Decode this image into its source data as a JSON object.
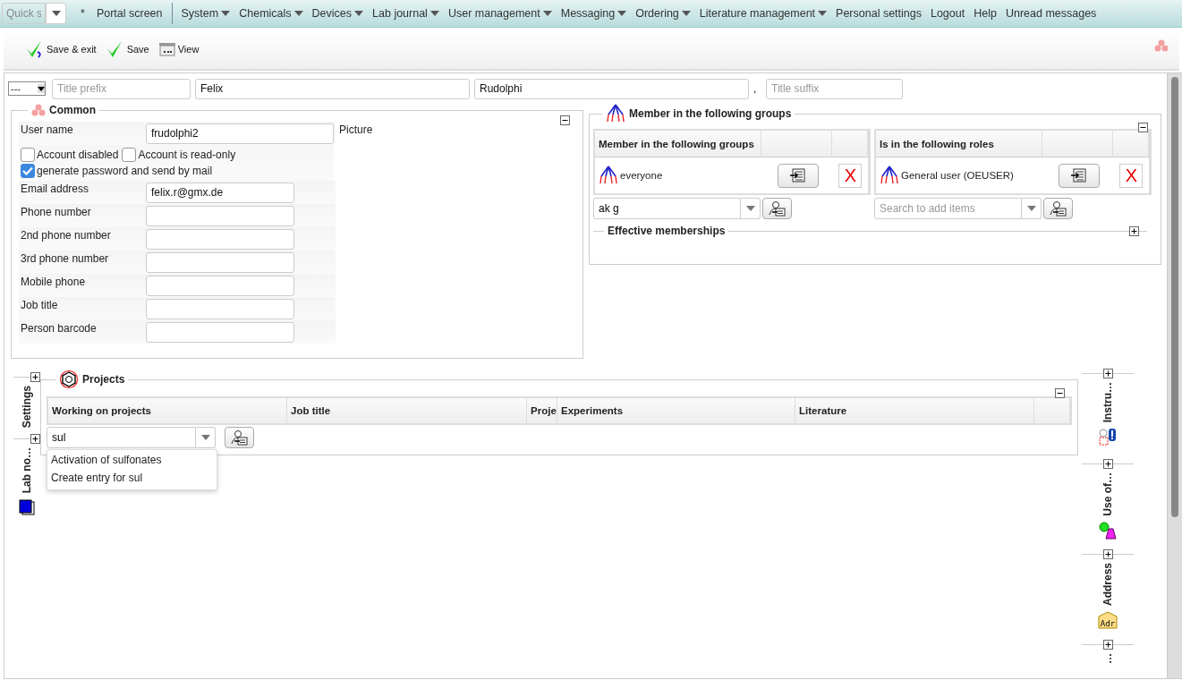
{
  "nav": {
    "quick_search": {
      "placeholder": "Quick s"
    },
    "pinned": [
      "*",
      "Portal screen"
    ],
    "menus": [
      {
        "label": "System",
        "has_menu": true
      },
      {
        "label": "Chemicals",
        "has_menu": true
      },
      {
        "label": "Devices",
        "has_menu": true
      },
      {
        "label": "Lab journal",
        "has_menu": true
      },
      {
        "label": "User management",
        "has_menu": true
      },
      {
        "label": "Messaging",
        "has_menu": true
      },
      {
        "label": "Ordering",
        "has_menu": true
      },
      {
        "label": "Literature management",
        "has_menu": true
      },
      {
        "label": "Personal settings",
        "has_menu": false
      },
      {
        "label": "Logout",
        "has_menu": false
      },
      {
        "label": "Help",
        "has_menu": false
      },
      {
        "label": "Unread messages",
        "has_menu": false
      }
    ]
  },
  "toolbar": [
    {
      "label": "Save & exit",
      "kind": "save_exit"
    },
    {
      "label": "Save",
      "kind": "save"
    },
    {
      "label": "View",
      "kind": "view"
    }
  ],
  "name_row": {
    "title_select": "---",
    "title_prefix": {
      "placeholder": "Title prefix"
    },
    "first_name": "Felix",
    "last_name": "Rudolphi",
    "separator": ",",
    "title_suffix": {
      "placeholder": "Title suffix"
    }
  },
  "common": {
    "title": "Common",
    "expanded": true,
    "user_name": {
      "label": "User name",
      "value": "frudolphi2"
    },
    "picture_label": "Picture",
    "checkboxes": [
      {
        "label": "Account disabled",
        "checked": false
      },
      {
        "label": "Account is read-only",
        "checked": false
      },
      {
        "label": "generate password and send by mail",
        "checked": true
      }
    ],
    "fields": [
      {
        "label": "Email address",
        "value": "felix.r@gmx.de"
      },
      {
        "label": "Phone number"
      },
      {
        "label": "2nd phone number"
      },
      {
        "label": "3rd phone number"
      },
      {
        "label": "Mobile phone"
      },
      {
        "label": "Job title"
      },
      {
        "label": "Person barcode"
      }
    ]
  },
  "membership": {
    "title": "Member in the following groups",
    "expanded": true,
    "tables": [
      {
        "column": "Member in the following groups",
        "rows": [
          {
            "name": "everyone",
            "remove": "X"
          }
        ],
        "search": {
          "value": "ak g"
        }
      },
      {
        "column": "Is in the following roles",
        "rows": [
          {
            "name": "General user (OEUSER)",
            "remove": "X"
          }
        ],
        "search": {
          "placeholder": "Search to add items"
        }
      }
    ],
    "effective": {
      "title": "Effective memberships",
      "expanded": false
    }
  },
  "left_tabs": [
    {
      "label": "Settings",
      "kind": "settings",
      "expanded": false
    },
    {
      "label": "Lab no…",
      "kind": "notebook",
      "expanded": false
    }
  ],
  "projects": {
    "title": "Projects",
    "expanded": true,
    "columns": [
      "Working on projects",
      "Job title",
      "Proje",
      "Experiments",
      "Literature"
    ],
    "search": {
      "value": "sul"
    },
    "suggestions": [
      "Activation of sulfonates",
      "Create entry for sul"
    ]
  },
  "right_tabs": [
    {
      "label": "Instru…",
      "kind": "instrument",
      "expanded": false
    },
    {
      "label": "Use of…",
      "kind": "usage",
      "expanded": false
    },
    {
      "label": "Address",
      "kind": "address",
      "expanded": false,
      "icon_text": "Adr"
    },
    {
      "label": "…",
      "kind": "more",
      "expanded": false
    }
  ]
}
